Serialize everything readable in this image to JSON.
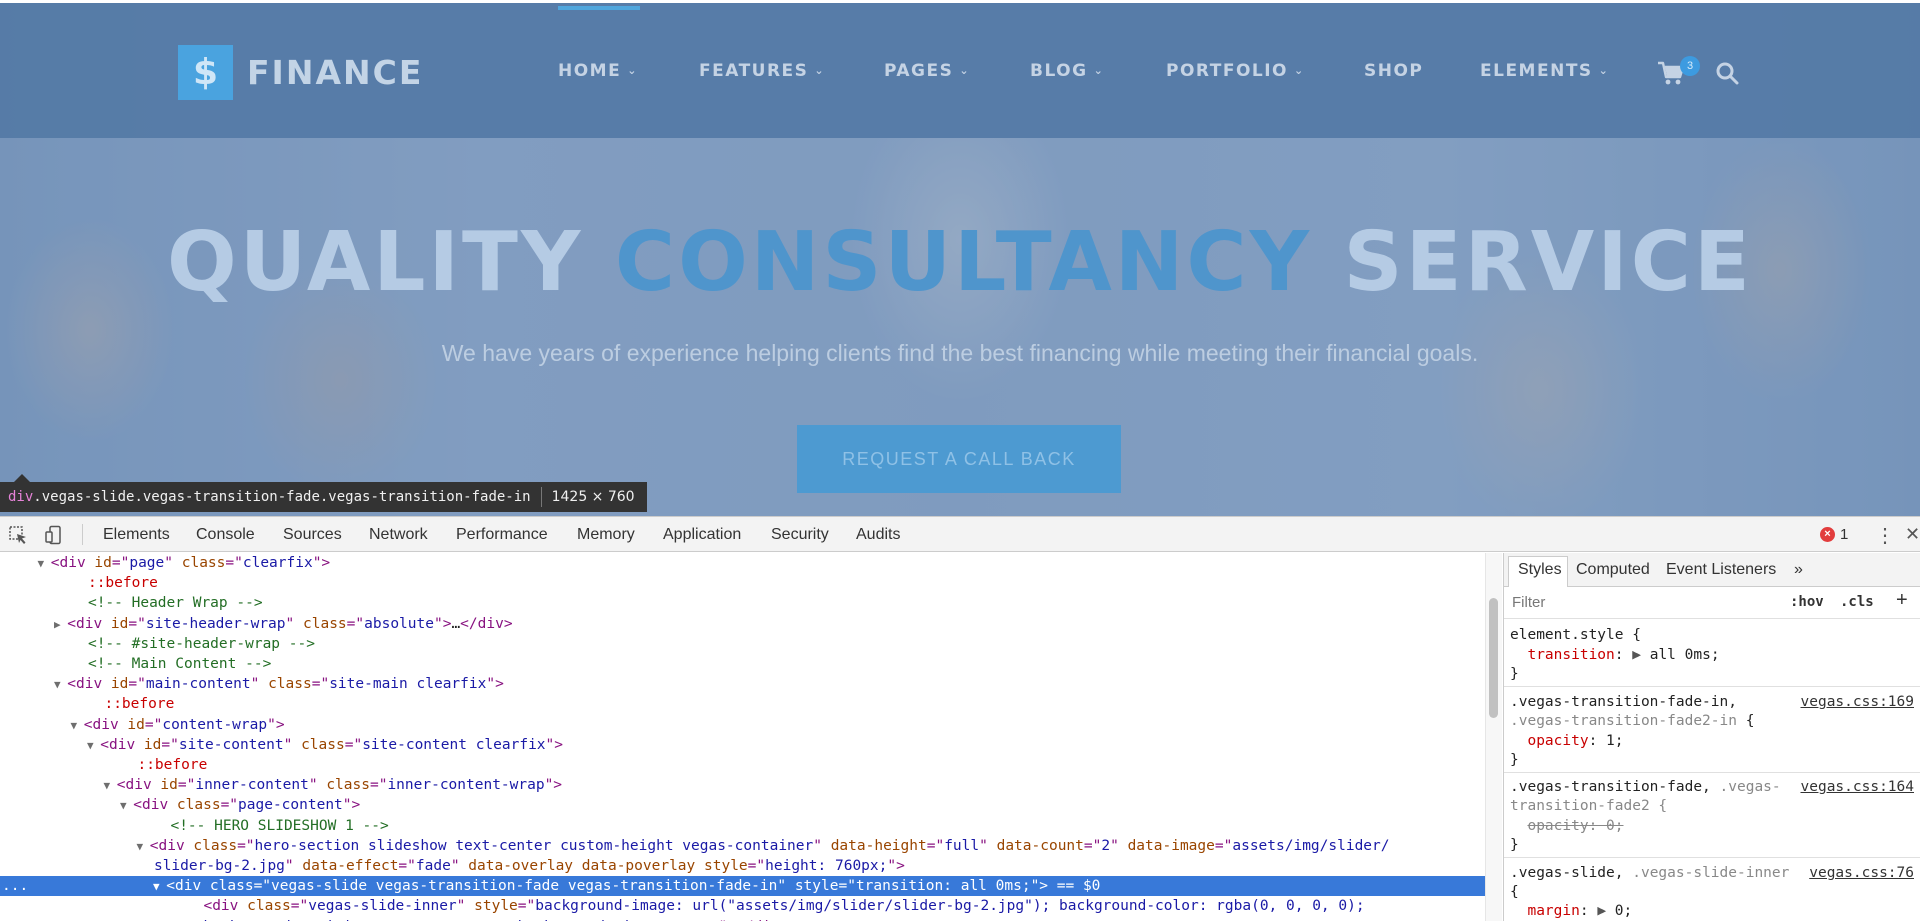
{
  "site": {
    "logo_mark": "$",
    "logo_text": "FINANCE",
    "nav": [
      {
        "label": "HOME",
        "caret": "⌄"
      },
      {
        "label": "FEATURES",
        "caret": "⌄"
      },
      {
        "label": "PAGES",
        "caret": "⌄"
      },
      {
        "label": "BLOG",
        "caret": "⌄"
      },
      {
        "label": "PORTFOLIO",
        "caret": "⌄"
      },
      {
        "label": "SHOP",
        "caret": ""
      },
      {
        "label": "ELEMENTS",
        "caret": "⌄"
      }
    ],
    "cart_count": "3",
    "hero_title_1": "QUALITY",
    "hero_title_accent": "CONSULTANCY",
    "hero_title_2": "SERVICE",
    "hero_subtitle": "We have years of experience helping clients find the best financing while meeting their financial goals.",
    "cta_label": "REQUEST A CALL BACK",
    "colors": {
      "accent": "#4aa3df",
      "header": "#547aa6"
    }
  },
  "inspect_tooltip": {
    "tag": "div",
    "classes": ".vegas-slide.vegas-transition-fade.vegas-transition-fade-in",
    "size": "1425 × 760"
  },
  "devtools": {
    "tabs": [
      "Elements",
      "Console",
      "Sources",
      "Network",
      "Performance",
      "Memory",
      "Application",
      "Security",
      "Audits"
    ],
    "error_count": "1",
    "dom_lines": [
      {
        "indent": 3,
        "tri": "▼",
        "parts": [
          [
            "tg",
            "<div "
          ],
          [
            "an",
            "id"
          ],
          [
            "tg",
            "=\""
          ],
          [
            "av",
            "page"
          ],
          [
            "tg",
            "\" "
          ],
          [
            "an",
            "class"
          ],
          [
            "tg",
            "=\""
          ],
          [
            "av",
            "clearfix"
          ],
          [
            "tg",
            "\">"
          ]
        ]
      },
      {
        "indent": 5,
        "tri": "",
        "parts": [
          [
            "ps",
            "::before"
          ]
        ]
      },
      {
        "indent": 5,
        "tri": "",
        "parts": [
          [
            "cm",
            "<!-- Header Wrap -->"
          ]
        ]
      },
      {
        "indent": 4,
        "tri": "▶",
        "parts": [
          [
            "tg",
            "<div "
          ],
          [
            "an",
            "id"
          ],
          [
            "tg",
            "=\""
          ],
          [
            "av",
            "site-header-wrap"
          ],
          [
            "tg",
            "\" "
          ],
          [
            "an",
            "class"
          ],
          [
            "tg",
            "=\""
          ],
          [
            "av",
            "absolute"
          ],
          [
            "tg",
            "\">"
          ],
          [
            "tx",
            "…"
          ],
          [
            "tg",
            "</div>"
          ]
        ]
      },
      {
        "indent": 5,
        "tri": "",
        "parts": [
          [
            "cm",
            "<!-- #site-header-wrap -->"
          ]
        ]
      },
      {
        "indent": 5,
        "tri": "",
        "parts": [
          [
            "cm",
            "<!-- Main Content -->"
          ]
        ]
      },
      {
        "indent": 4,
        "tri": "▼",
        "parts": [
          [
            "tg",
            "<div "
          ],
          [
            "an",
            "id"
          ],
          [
            "tg",
            "=\""
          ],
          [
            "av",
            "main-content"
          ],
          [
            "tg",
            "\" "
          ],
          [
            "an",
            "class"
          ],
          [
            "tg",
            "=\""
          ],
          [
            "av",
            "site-main clearfix"
          ],
          [
            "tg",
            "\">"
          ]
        ]
      },
      {
        "indent": 6,
        "tri": "",
        "parts": [
          [
            "ps",
            "::before"
          ]
        ]
      },
      {
        "indent": 5,
        "tri": "▼",
        "parts": [
          [
            "tg",
            "<div "
          ],
          [
            "an",
            "id"
          ],
          [
            "tg",
            "=\""
          ],
          [
            "av",
            "content-wrap"
          ],
          [
            "tg",
            "\">"
          ]
        ]
      },
      {
        "indent": 6,
        "tri": "▼",
        "parts": [
          [
            "tg",
            "<div "
          ],
          [
            "an",
            "id"
          ],
          [
            "tg",
            "=\""
          ],
          [
            "av",
            "site-content"
          ],
          [
            "tg",
            "\" "
          ],
          [
            "an",
            "class"
          ],
          [
            "tg",
            "=\""
          ],
          [
            "av",
            "site-content clearfix"
          ],
          [
            "tg",
            "\">"
          ]
        ]
      },
      {
        "indent": 8,
        "tri": "",
        "parts": [
          [
            "ps",
            "::before"
          ]
        ]
      },
      {
        "indent": 7,
        "tri": "▼",
        "parts": [
          [
            "tg",
            "<div "
          ],
          [
            "an",
            "id"
          ],
          [
            "tg",
            "=\""
          ],
          [
            "av",
            "inner-content"
          ],
          [
            "tg",
            "\" "
          ],
          [
            "an",
            "class"
          ],
          [
            "tg",
            "=\""
          ],
          [
            "av",
            "inner-content-wrap"
          ],
          [
            "tg",
            "\">"
          ]
        ]
      },
      {
        "indent": 8,
        "tri": "▼",
        "parts": [
          [
            "tg",
            "<div "
          ],
          [
            "an",
            "class"
          ],
          [
            "tg",
            "=\""
          ],
          [
            "av",
            "page-content"
          ],
          [
            "tg",
            "\">"
          ]
        ]
      },
      {
        "indent": 10,
        "tri": "",
        "parts": [
          [
            "cm",
            "<!-- HERO SLIDESHOW 1 -->"
          ]
        ]
      },
      {
        "indent": 9,
        "tri": "▼",
        "parts": [
          [
            "tg",
            "<div "
          ],
          [
            "an",
            "class"
          ],
          [
            "tg",
            "=\""
          ],
          [
            "av",
            "hero-section slideshow text-center custom-height vegas-container"
          ],
          [
            "tg",
            "\" "
          ],
          [
            "an",
            "data-height"
          ],
          [
            "tg",
            "=\""
          ],
          [
            "av",
            "full"
          ],
          [
            "tg",
            "\" "
          ],
          [
            "an",
            "data-count"
          ],
          [
            "tg",
            "=\""
          ],
          [
            "av",
            "2"
          ],
          [
            "tg",
            "\" "
          ],
          [
            "an",
            "data-image"
          ],
          [
            "tg",
            "=\""
          ],
          [
            "av",
            "assets/img/slider/"
          ]
        ]
      },
      {
        "indent": 9,
        "tri": "",
        "parts": [
          [
            "av",
            "slider-bg-2.jpg"
          ],
          [
            "tg",
            "\" "
          ],
          [
            "an",
            "data-effect"
          ],
          [
            "tg",
            "=\""
          ],
          [
            "av",
            "fade"
          ],
          [
            "tg",
            "\" "
          ],
          [
            "an",
            "data-overlay"
          ],
          [
            "tg",
            " "
          ],
          [
            "an",
            "data-poverlay"
          ],
          [
            "tg",
            " "
          ],
          [
            "an",
            "style"
          ],
          [
            "tg",
            "=\""
          ],
          [
            "av",
            "height: 760px;"
          ],
          [
            "tg",
            "\">"
          ]
        ]
      },
      {
        "indent": 10,
        "tri": "▼",
        "selected": true,
        "parts": [
          [
            "tg",
            "<div "
          ],
          [
            "an",
            "class"
          ],
          [
            "tg",
            "=\""
          ],
          [
            "av",
            "vegas-slide vegas-transition-fade vegas-transition-fade-in"
          ],
          [
            "tg",
            "\" "
          ],
          [
            "an",
            "style"
          ],
          [
            "tg",
            "=\""
          ],
          [
            "av",
            "transition: all 0ms;"
          ],
          [
            "tg",
            "\">"
          ],
          [
            "tx",
            " == $0"
          ]
        ]
      },
      {
        "indent": 12,
        "tri": "",
        "parts": [
          [
            "tg",
            "<div "
          ],
          [
            "an",
            "class"
          ],
          [
            "tg",
            "=\""
          ],
          [
            "av",
            "vegas-slide-inner"
          ],
          [
            "tg",
            "\" "
          ],
          [
            "an",
            "style"
          ],
          [
            "tg",
            "=\""
          ],
          [
            "av",
            "background-image: url(\"assets/img/slider/slider-bg-2.jpg\"); background-color: rgba(0, 0, 0, 0);"
          ]
        ]
      },
      {
        "indent": 12,
        "tri": "",
        "parts": [
          [
            "av",
            "background-position: center center; background-size: cover;"
          ],
          [
            "tg",
            "\"></div>"
          ]
        ]
      }
    ],
    "selected_gutter": "...",
    "styles": {
      "tabs": [
        "Styles",
        "Computed",
        "Event Listeners",
        "»"
      ],
      "filter_placeholder": "Filter",
      "hov": ":hov",
      "cls": ".cls",
      "add": "+",
      "element_style_selector": "element.style {",
      "element_style_prop": "transition",
      "element_style_value": "all 0ms;",
      "rule1_selector_a": ".vegas-transition-fade-in,",
      "rule1_selector_b": ".vegas-transition-fade2-in {",
      "rule1_source": "vegas.css:169",
      "rule1_prop": "opacity",
      "rule1_value": "1;",
      "rule2_selector_a": ".vegas-transition-fade,",
      "rule2_selector_a2": " .vegas-",
      "rule2_selector_b": "transition-fade2 {",
      "rule2_source": "vegas.css:164",
      "rule2_prop_struck": "opacity: 0;",
      "rule3_selector_a": ".vegas-slide,",
      "rule3_selector_a2": " .vegas-slide-inner",
      "rule3_selector_b": "{",
      "rule3_source": "vegas.css:76",
      "rule3_prop": "margin",
      "rule3_value": "0;",
      "close_brace": "}",
      "expand_tri": "▶"
    }
  }
}
